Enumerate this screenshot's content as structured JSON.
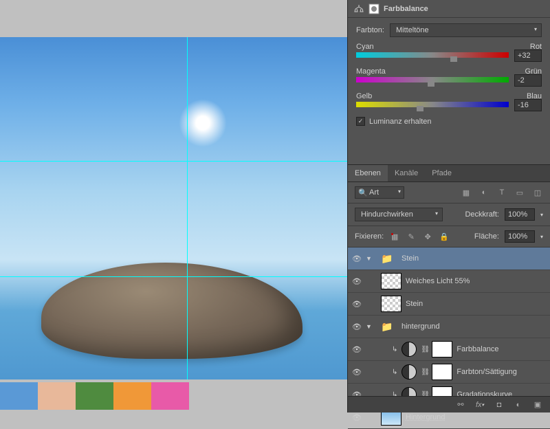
{
  "colorBalance": {
    "title": "Farbbalance",
    "toneLabel": "Farbton:",
    "toneValue": "Mitteltöne",
    "sliders": [
      {
        "left": "Cyan",
        "right": "Rot",
        "value": "+32",
        "pos": 64,
        "g1": "#00ccdd",
        "g2": "#cc0000"
      },
      {
        "left": "Magenta",
        "right": "Grün",
        "value": "-2",
        "pos": 49,
        "g1": "#cc00cc",
        "g2": "#00aa00"
      },
      {
        "left": "Gelb",
        "right": "Blau",
        "value": "-16",
        "pos": 42,
        "g1": "#dddd00",
        "g2": "#0000cc"
      }
    ],
    "preserveLum": "Luminanz erhalten"
  },
  "layersPanel": {
    "tabs": [
      "Ebenen",
      "Kanäle",
      "Pfade"
    ],
    "search": "Art",
    "blendMode": "Hindurchwirken",
    "opacityLabel": "Deckkraft:",
    "opacityValue": "100%",
    "lockLabel": "Fixieren:",
    "fillLabel": "Fläche:",
    "fillValue": "100%",
    "layers": [
      {
        "type": "group",
        "name": "Stein",
        "selected": true,
        "open": true,
        "indent": 0
      },
      {
        "type": "layer",
        "name": "Weiches Licht 55%",
        "thumb": "chk",
        "indent": 1
      },
      {
        "type": "layer",
        "name": "Stein",
        "thumb": "chk",
        "indent": 1
      },
      {
        "type": "group",
        "name": "hintergrund",
        "open": true,
        "indent": 0
      },
      {
        "type": "adj",
        "name": "Farbbalance",
        "indent": 2,
        "clip": true
      },
      {
        "type": "adj",
        "name": "Farbton/Sättigung",
        "indent": 2,
        "clip": true
      },
      {
        "type": "adj",
        "name": "Gradationskurve",
        "indent": 2,
        "clip": true
      },
      {
        "type": "layer",
        "name": "Hintergrund",
        "thumb": "sky",
        "underline": true,
        "indent": 1
      }
    ]
  },
  "guides": {
    "v": [
      272
    ],
    "h": [
      180,
      348
    ]
  },
  "swatches": [
    "#5a99d6",
    "#e8b89a",
    "#4f8b3f",
    "#f09838",
    "#e85aa8"
  ]
}
